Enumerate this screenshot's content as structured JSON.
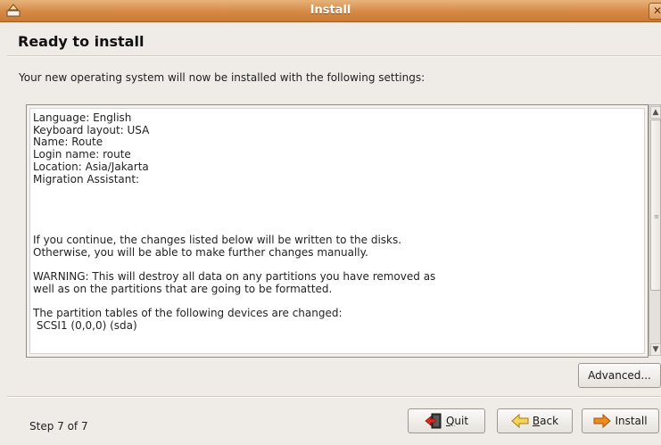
{
  "window": {
    "title": "Install",
    "close_glyph": "✕"
  },
  "page": {
    "heading": "Ready to install",
    "intro": "Your new operating system will now be installed with the following settings:"
  },
  "summary": {
    "text": "Language: English\nKeyboard layout: USA\nName: Route\nLogin name: route\nLocation: Asia/Jakarta\nMigration Assistant:\n\n\n\n\nIf you continue, the changes listed below will be written to the disks.\nOtherwise, you will be able to make further changes manually.\n\nWARNING: This will destroy all data on any partitions you have removed as\nwell as on the partitions that are going to be formatted.\n\nThe partition tables of the following devices are changed:\n SCSI1 (0,0,0) (sda)"
  },
  "buttons": {
    "advanced": "Advanced...",
    "quit_mnemonic": "Q",
    "quit_rest": "uit",
    "back_mnemonic": "B",
    "back_rest": "ack",
    "install": "Install"
  },
  "footer": {
    "step": "Step 7 of 7"
  },
  "icons": {
    "app": "installer-icon",
    "quit": "quit-icon",
    "back": "back-arrow-icon",
    "install": "forward-arrow-icon"
  },
  "colors": {
    "titlebar": "#d58a45",
    "accent_arrow": "#f08a1c",
    "quit_red": "#d42a1f"
  }
}
